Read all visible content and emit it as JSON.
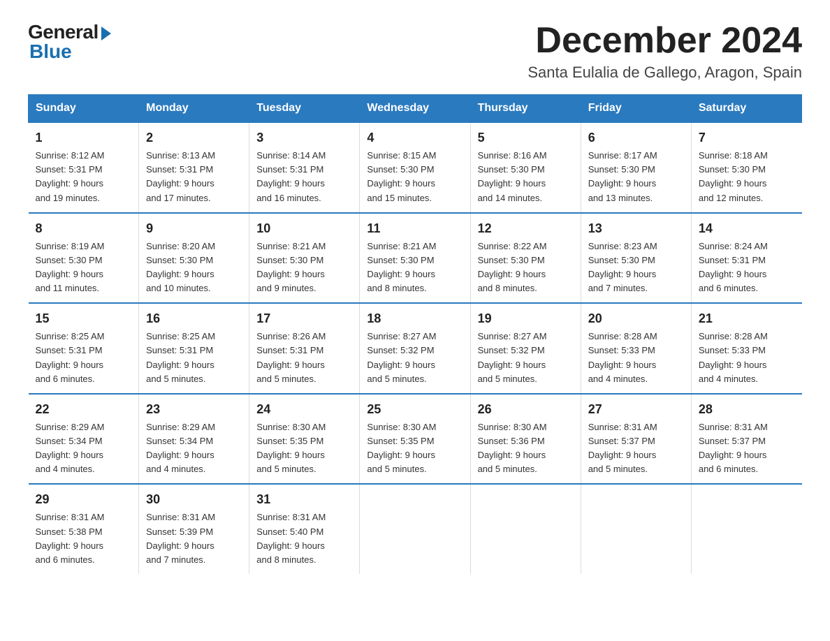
{
  "logo": {
    "general": "General",
    "blue": "Blue"
  },
  "header": {
    "month": "December 2024",
    "location": "Santa Eulalia de Gallego, Aragon, Spain"
  },
  "weekdays": [
    "Sunday",
    "Monday",
    "Tuesday",
    "Wednesday",
    "Thursday",
    "Friday",
    "Saturday"
  ],
  "weeks": [
    [
      {
        "day": "1",
        "info": "Sunrise: 8:12 AM\nSunset: 5:31 PM\nDaylight: 9 hours\nand 19 minutes."
      },
      {
        "day": "2",
        "info": "Sunrise: 8:13 AM\nSunset: 5:31 PM\nDaylight: 9 hours\nand 17 minutes."
      },
      {
        "day": "3",
        "info": "Sunrise: 8:14 AM\nSunset: 5:31 PM\nDaylight: 9 hours\nand 16 minutes."
      },
      {
        "day": "4",
        "info": "Sunrise: 8:15 AM\nSunset: 5:30 PM\nDaylight: 9 hours\nand 15 minutes."
      },
      {
        "day": "5",
        "info": "Sunrise: 8:16 AM\nSunset: 5:30 PM\nDaylight: 9 hours\nand 14 minutes."
      },
      {
        "day": "6",
        "info": "Sunrise: 8:17 AM\nSunset: 5:30 PM\nDaylight: 9 hours\nand 13 minutes."
      },
      {
        "day": "7",
        "info": "Sunrise: 8:18 AM\nSunset: 5:30 PM\nDaylight: 9 hours\nand 12 minutes."
      }
    ],
    [
      {
        "day": "8",
        "info": "Sunrise: 8:19 AM\nSunset: 5:30 PM\nDaylight: 9 hours\nand 11 minutes."
      },
      {
        "day": "9",
        "info": "Sunrise: 8:20 AM\nSunset: 5:30 PM\nDaylight: 9 hours\nand 10 minutes."
      },
      {
        "day": "10",
        "info": "Sunrise: 8:21 AM\nSunset: 5:30 PM\nDaylight: 9 hours\nand 9 minutes."
      },
      {
        "day": "11",
        "info": "Sunrise: 8:21 AM\nSunset: 5:30 PM\nDaylight: 9 hours\nand 8 minutes."
      },
      {
        "day": "12",
        "info": "Sunrise: 8:22 AM\nSunset: 5:30 PM\nDaylight: 9 hours\nand 8 minutes."
      },
      {
        "day": "13",
        "info": "Sunrise: 8:23 AM\nSunset: 5:30 PM\nDaylight: 9 hours\nand 7 minutes."
      },
      {
        "day": "14",
        "info": "Sunrise: 8:24 AM\nSunset: 5:31 PM\nDaylight: 9 hours\nand 6 minutes."
      }
    ],
    [
      {
        "day": "15",
        "info": "Sunrise: 8:25 AM\nSunset: 5:31 PM\nDaylight: 9 hours\nand 6 minutes."
      },
      {
        "day": "16",
        "info": "Sunrise: 8:25 AM\nSunset: 5:31 PM\nDaylight: 9 hours\nand 5 minutes."
      },
      {
        "day": "17",
        "info": "Sunrise: 8:26 AM\nSunset: 5:31 PM\nDaylight: 9 hours\nand 5 minutes."
      },
      {
        "day": "18",
        "info": "Sunrise: 8:27 AM\nSunset: 5:32 PM\nDaylight: 9 hours\nand 5 minutes."
      },
      {
        "day": "19",
        "info": "Sunrise: 8:27 AM\nSunset: 5:32 PM\nDaylight: 9 hours\nand 5 minutes."
      },
      {
        "day": "20",
        "info": "Sunrise: 8:28 AM\nSunset: 5:33 PM\nDaylight: 9 hours\nand 4 minutes."
      },
      {
        "day": "21",
        "info": "Sunrise: 8:28 AM\nSunset: 5:33 PM\nDaylight: 9 hours\nand 4 minutes."
      }
    ],
    [
      {
        "day": "22",
        "info": "Sunrise: 8:29 AM\nSunset: 5:34 PM\nDaylight: 9 hours\nand 4 minutes."
      },
      {
        "day": "23",
        "info": "Sunrise: 8:29 AM\nSunset: 5:34 PM\nDaylight: 9 hours\nand 4 minutes."
      },
      {
        "day": "24",
        "info": "Sunrise: 8:30 AM\nSunset: 5:35 PM\nDaylight: 9 hours\nand 5 minutes."
      },
      {
        "day": "25",
        "info": "Sunrise: 8:30 AM\nSunset: 5:35 PM\nDaylight: 9 hours\nand 5 minutes."
      },
      {
        "day": "26",
        "info": "Sunrise: 8:30 AM\nSunset: 5:36 PM\nDaylight: 9 hours\nand 5 minutes."
      },
      {
        "day": "27",
        "info": "Sunrise: 8:31 AM\nSunset: 5:37 PM\nDaylight: 9 hours\nand 5 minutes."
      },
      {
        "day": "28",
        "info": "Sunrise: 8:31 AM\nSunset: 5:37 PM\nDaylight: 9 hours\nand 6 minutes."
      }
    ],
    [
      {
        "day": "29",
        "info": "Sunrise: 8:31 AM\nSunset: 5:38 PM\nDaylight: 9 hours\nand 6 minutes."
      },
      {
        "day": "30",
        "info": "Sunrise: 8:31 AM\nSunset: 5:39 PM\nDaylight: 9 hours\nand 7 minutes."
      },
      {
        "day": "31",
        "info": "Sunrise: 8:31 AM\nSunset: 5:40 PM\nDaylight: 9 hours\nand 8 minutes."
      },
      null,
      null,
      null,
      null
    ]
  ]
}
